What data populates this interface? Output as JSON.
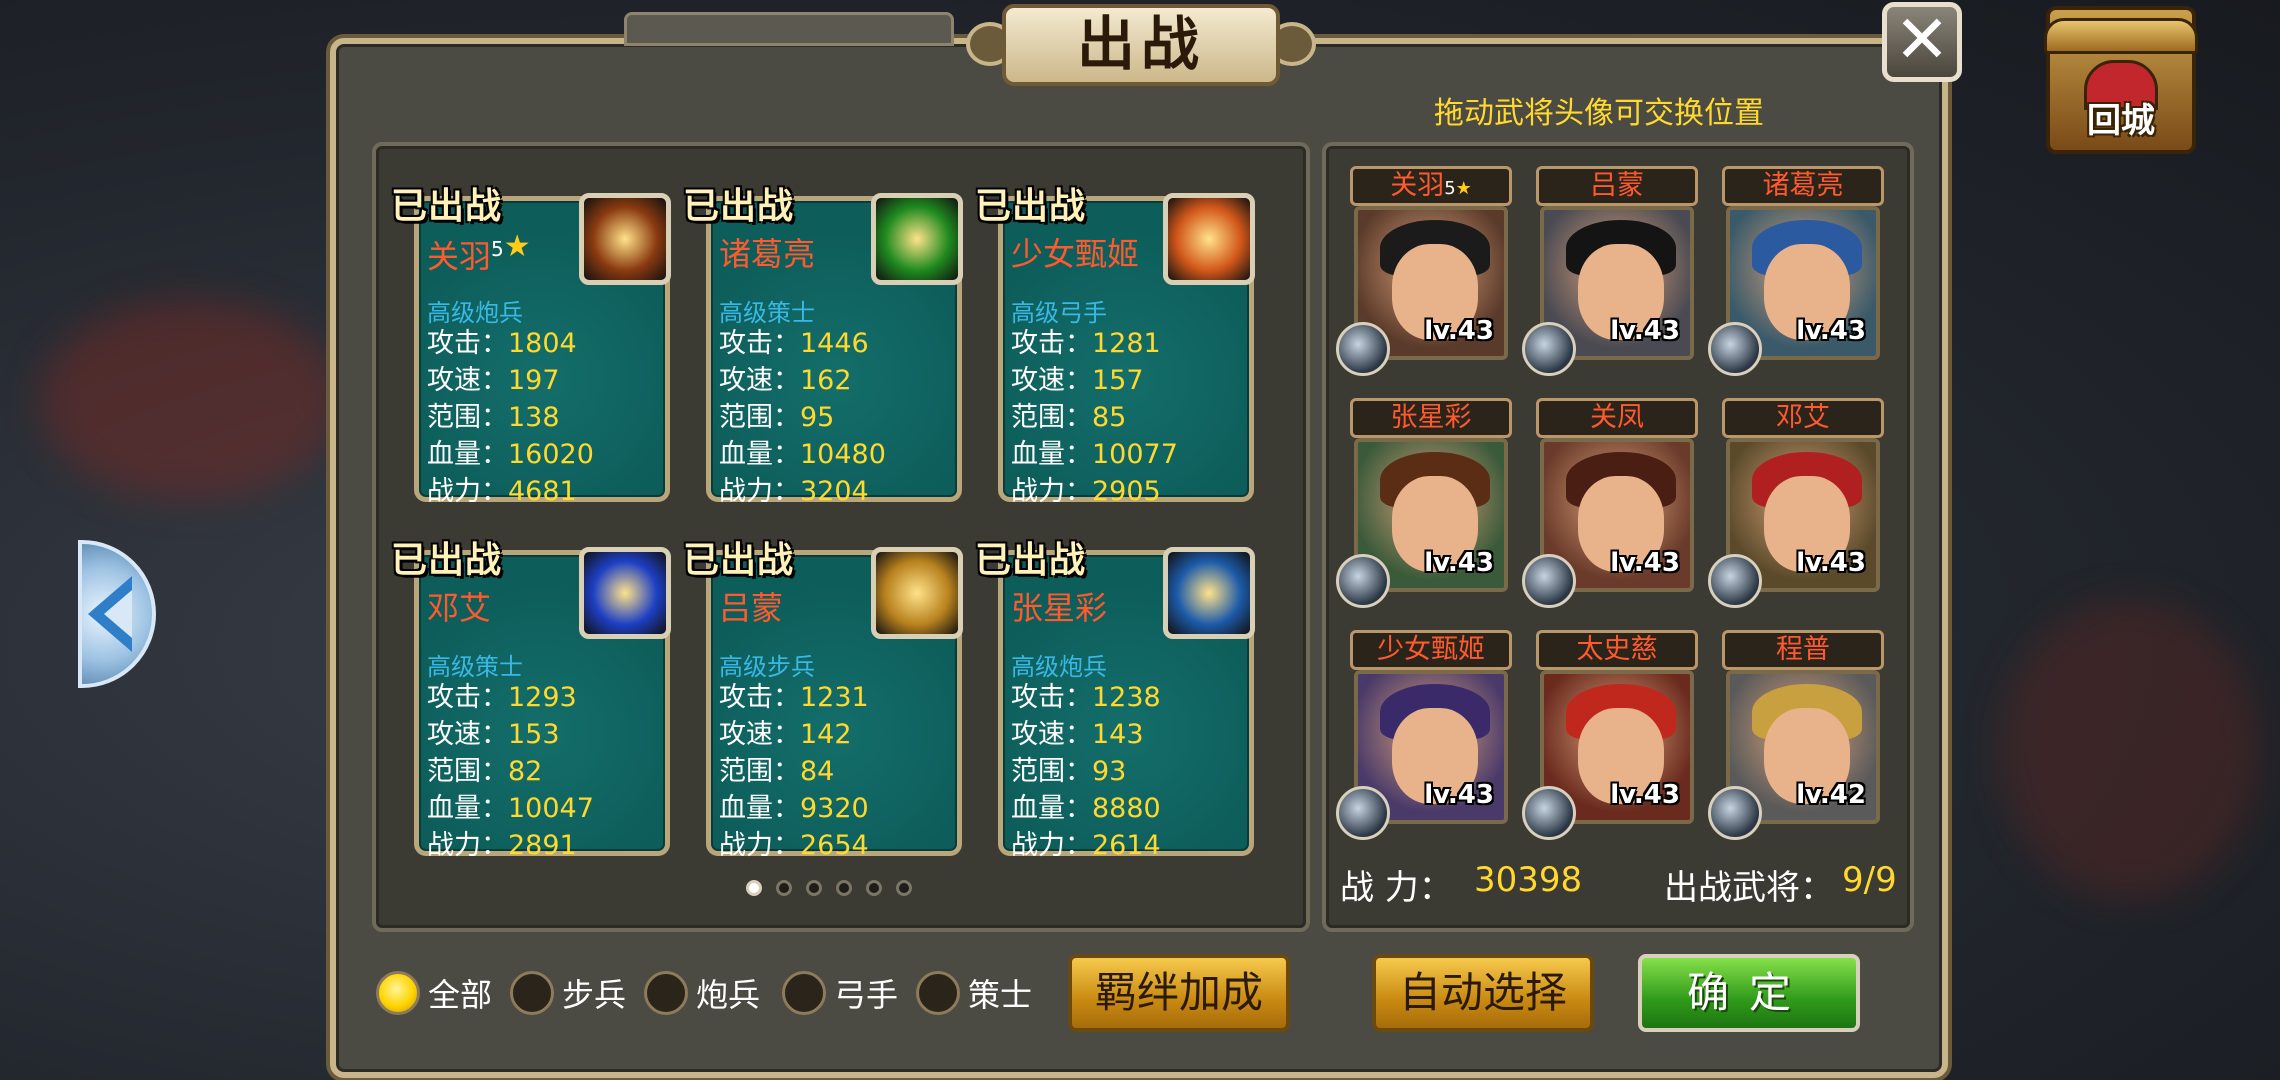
{
  "title": "出战",
  "hint": "拖动武将头像可交换位置",
  "return_city": "回城",
  "close_symbol": "✕",
  "deployed_cards": [
    {
      "badge": "已出战",
      "name": "关羽",
      "stars": "5",
      "class": "高级炮兵",
      "skill_icon": "cannonball-skill-icon",
      "skill_color": "#8a3a10",
      "stats": [
        {
          "label": "攻击：",
          "value": "1804"
        },
        {
          "label": "攻速：",
          "value": "197"
        },
        {
          "label": "范围：",
          "value": "138"
        },
        {
          "label": "血量：",
          "value": "16020"
        },
        {
          "label": "战力：",
          "value": "4681"
        }
      ]
    },
    {
      "badge": "已出战",
      "name": "诸葛亮",
      "stars": "",
      "class": "高级策士",
      "skill_icon": "green-aura-skill-icon",
      "skill_color": "#1f8a1f",
      "stats": [
        {
          "label": "攻击：",
          "value": "1446"
        },
        {
          "label": "攻速：",
          "value": "162"
        },
        {
          "label": "范围：",
          "value": "95"
        },
        {
          "label": "血量：",
          "value": "10480"
        },
        {
          "label": "战力：",
          "value": "3204"
        }
      ]
    },
    {
      "badge": "已出战",
      "name": "少女甄姬",
      "stars": "",
      "class": "高级弓手",
      "skill_icon": "flame-arrow-skill-icon",
      "skill_color": "#d2571a",
      "stats": [
        {
          "label": "攻击：",
          "value": "1281"
        },
        {
          "label": "攻速：",
          "value": "157"
        },
        {
          "label": "范围：",
          "value": "85"
        },
        {
          "label": "血量：",
          "value": "10077"
        },
        {
          "label": "战力：",
          "value": "2905"
        }
      ]
    },
    {
      "badge": "已出战",
      "name": "邓艾",
      "stars": "",
      "class": "高级策士",
      "skill_icon": "crossed-swords-skill-icon",
      "skill_color": "#1d3fc4",
      "stats": [
        {
          "label": "攻击：",
          "value": "1293"
        },
        {
          "label": "攻速：",
          "value": "153"
        },
        {
          "label": "范围：",
          "value": "82"
        },
        {
          "label": "血量：",
          "value": "10047"
        },
        {
          "label": "战力：",
          "value": "2891"
        }
      ]
    },
    {
      "badge": "已出战",
      "name": "吕蒙",
      "stars": "",
      "class": "高级步兵",
      "skill_icon": "shield-skill-icon",
      "skill_color": "#b8821e",
      "stats": [
        {
          "label": "攻击：",
          "value": "1231"
        },
        {
          "label": "攻速：",
          "value": "142"
        },
        {
          "label": "范围：",
          "value": "84"
        },
        {
          "label": "血量：",
          "value": "9320"
        },
        {
          "label": "战力：",
          "value": "2654"
        }
      ]
    },
    {
      "badge": "已出战",
      "name": "张星彩",
      "stars": "",
      "class": "高级炮兵",
      "skill_icon": "bomb-skill-icon",
      "skill_color": "#1c5aa8",
      "stats": [
        {
          "label": "攻击：",
          "value": "1238"
        },
        {
          "label": "攻速：",
          "value": "143"
        },
        {
          "label": "范围：",
          "value": "93"
        },
        {
          "label": "血量：",
          "value": "8880"
        },
        {
          "label": "战力：",
          "value": "2614"
        }
      ]
    }
  ],
  "pagination": {
    "pages": 6,
    "current": 1
  },
  "lineup": [
    {
      "name": "关羽",
      "stars": "5",
      "level": "lv.43",
      "type_icon": "bomb-icon",
      "hair": "#1b1b1b",
      "bg": "#5a3a2a"
    },
    {
      "name": "吕蒙",
      "stars": "",
      "level": "lv.43",
      "type_icon": "sword-icon",
      "hair": "#141414",
      "bg": "#4a4a52"
    },
    {
      "name": "诸葛亮",
      "stars": "",
      "level": "lv.43",
      "type_icon": "fan-icon",
      "hair": "#2b5aa0",
      "bg": "#3a5a6a"
    },
    {
      "name": "张星彩",
      "stars": "",
      "level": "lv.43",
      "type_icon": "bomb-icon",
      "hair": "#5a2d14",
      "bg": "#3a5a3a"
    },
    {
      "name": "关凤",
      "stars": "",
      "level": "lv.43",
      "type_icon": "bomb-icon",
      "hair": "#4a1e12",
      "bg": "#6a3a2a"
    },
    {
      "name": "邓艾",
      "stars": "",
      "level": "lv.43",
      "type_icon": "fan-icon",
      "hair": "#b02020",
      "bg": "#5a4a2a"
    },
    {
      "name": "少女甄姬",
      "stars": "",
      "level": "lv.43",
      "type_icon": "crossbow-icon",
      "hair": "#3a2a6a",
      "bg": "#4a3a6a"
    },
    {
      "name": "太史慈",
      "stars": "",
      "level": "lv.43",
      "type_icon": "crossbow-icon",
      "hair": "#c0281e",
      "bg": "#6a2a1e"
    },
    {
      "name": "程普",
      "stars": "",
      "level": "lv.42",
      "type_icon": "sword-icon",
      "hair": "#c8a040",
      "bg": "#5a5a5a"
    }
  ],
  "power": {
    "label": "战 力：",
    "value": "30398"
  },
  "deploy_count": {
    "label": "出战武将：",
    "value": "9/9"
  },
  "filters": [
    {
      "label": "全部",
      "selected": true
    },
    {
      "label": "步兵",
      "selected": false
    },
    {
      "label": "炮兵",
      "selected": false
    },
    {
      "label": "弓手",
      "selected": false
    },
    {
      "label": "策士",
      "selected": false
    }
  ],
  "buttons": {
    "bond": "羁绊加成",
    "auto": "自动选择",
    "confirm": "确定"
  },
  "colors": {
    "accent_yellow": "#ffd92e",
    "name_red": "#ff5a2e",
    "class_blue": "#39b8e6",
    "card_teal": "#0d5d5a"
  }
}
